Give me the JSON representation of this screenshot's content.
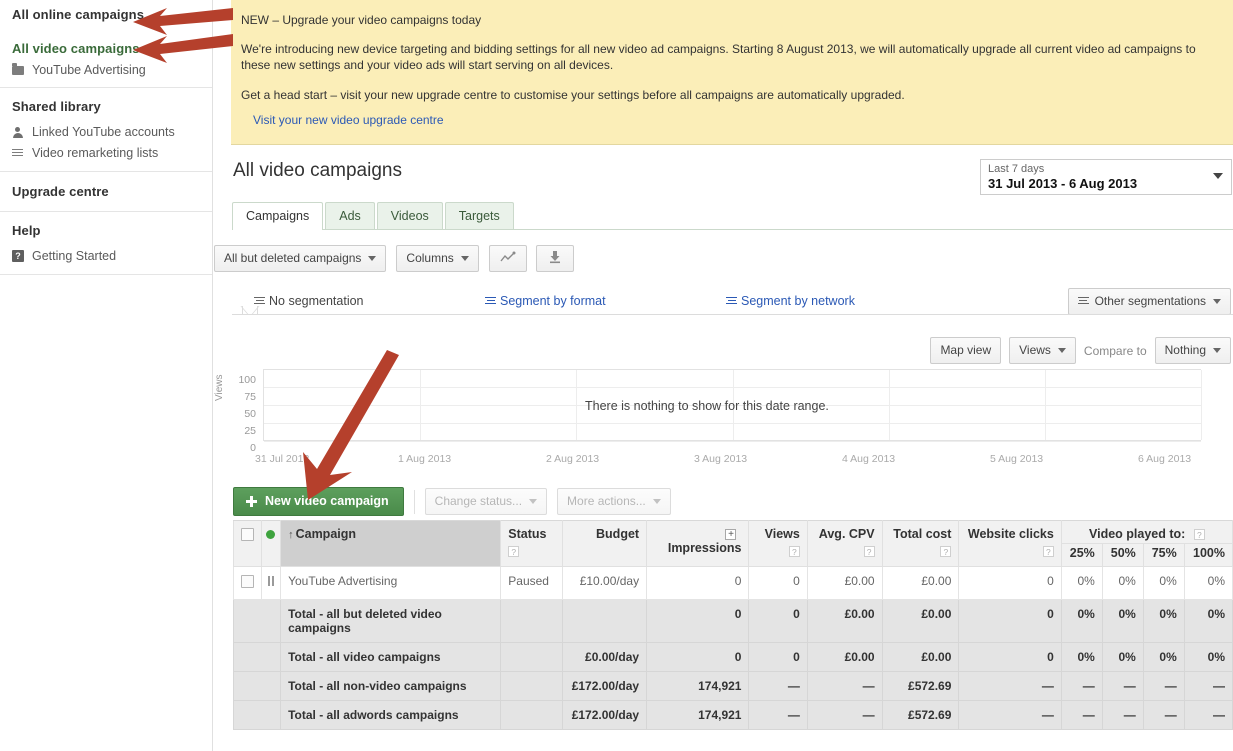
{
  "sidebar": {
    "sections": [
      {
        "items": [
          {
            "label": "All online campaigns",
            "style": "head-dark",
            "icon": ""
          },
          {
            "label": "All video campaigns",
            "style": "head-green",
            "icon": ""
          },
          {
            "label": "YouTube Advertising",
            "style": "row",
            "icon": "folder-icon"
          }
        ]
      },
      {
        "items": [
          {
            "label": "Shared library",
            "style": "head-dark",
            "icon": ""
          },
          {
            "label": "Linked YouTube accounts",
            "style": "row",
            "icon": "person-icon"
          },
          {
            "label": "Video remarketing lists",
            "style": "row",
            "icon": "list-icon"
          }
        ]
      },
      {
        "items": [
          {
            "label": "Upgrade centre",
            "style": "head-dark",
            "icon": ""
          }
        ]
      },
      {
        "items": [
          {
            "label": "Help",
            "style": "head-dark",
            "icon": ""
          },
          {
            "label": "Getting Started",
            "style": "row",
            "icon": "help-icon"
          }
        ]
      }
    ]
  },
  "banner": {
    "heading": "NEW – Upgrade your video campaigns today",
    "paragraph1": "We're introducing new device targeting and bidding settings for all new video ad campaigns. Starting 8 August 2013, we will automatically upgrade all current video ad campaigns to these new settings and your video ads will start serving on all devices.",
    "paragraph2": "Get a head start – visit your new upgrade centre to customise your settings before all campaigns are automatically upgraded.",
    "link": "Visit your new video upgrade centre",
    "bg_color": "#fbeeb8"
  },
  "header": {
    "title": "All video campaigns",
    "date_range": {
      "preset": "Last 7 days",
      "range": "31 Jul 2013 - 6 Aug 2013"
    }
  },
  "tabs": [
    {
      "label": "Campaigns",
      "active": true
    },
    {
      "label": "Ads",
      "active": false
    },
    {
      "label": "Videos",
      "active": false
    },
    {
      "label": "Targets",
      "active": false
    }
  ],
  "toolbar": {
    "filter_label": "All but deleted campaigns",
    "columns_label": "Columns",
    "graph_icon": "line-chart-icon",
    "download_icon": "download-icon"
  },
  "segmentation": {
    "no_segmentation": "No segmentation",
    "by_format": "Segment by format",
    "by_network": "Segment by network",
    "other": "Other segmentations"
  },
  "chart_controls": {
    "map_view": "Map view",
    "views": "Views",
    "compare_to": "Compare to",
    "nothing": "Nothing"
  },
  "chart_data": {
    "type": "line",
    "title": "",
    "empty_message": "There is nothing to show for this date range.",
    "xlabel": "",
    "ylabel": "Views",
    "ylim": [
      0,
      100
    ],
    "yticks": [
      100,
      75,
      50,
      25,
      0
    ],
    "x": [
      "31 Jul 2013",
      "1 Aug 2013",
      "2 Aug 2013",
      "3 Aug 2013",
      "4 Aug 2013",
      "5 Aug 2013",
      "6 Aug 2013"
    ],
    "series": [
      {
        "name": "Views",
        "values": []
      }
    ],
    "grid": true,
    "legend": "none"
  },
  "actions": {
    "new_campaign": "New video campaign",
    "change_status": "Change status...",
    "more_actions": "More actions..."
  },
  "table": {
    "headers": {
      "campaign": "Campaign",
      "status": "Status",
      "budget": "Budget",
      "impressions": "Impressions",
      "views": "Views",
      "avg_cpv": "Avg. CPV",
      "total_cost": "Total cost",
      "website_clicks": "Website clicks",
      "video_played_to": "Video played to:",
      "vpt_sub": [
        "25%",
        "50%",
        "75%",
        "100%"
      ]
    },
    "rows": [
      {
        "type": "data",
        "name": "YouTube Advertising",
        "status": "Paused",
        "budget": "£10.00/day",
        "impressions": "0",
        "views": "0",
        "avg_cpv": "£0.00",
        "total_cost": "£0.00",
        "website_clicks": "0",
        "vpt": [
          "0%",
          "0%",
          "0%",
          "0%"
        ]
      },
      {
        "type": "total",
        "name": "Total - all but deleted video campaigns",
        "status": "",
        "budget": "",
        "impressions": "0",
        "views": "0",
        "avg_cpv": "£0.00",
        "total_cost": "£0.00",
        "website_clicks": "0",
        "vpt": [
          "0%",
          "0%",
          "0%",
          "0%"
        ]
      },
      {
        "type": "total",
        "name": "Total - all video campaigns",
        "status": "",
        "budget": "£0.00/day",
        "impressions": "0",
        "views": "0",
        "avg_cpv": "£0.00",
        "total_cost": "£0.00",
        "website_clicks": "0",
        "vpt": [
          "0%",
          "0%",
          "0%",
          "0%"
        ]
      },
      {
        "type": "total",
        "name": "Total - all non-video campaigns",
        "status": "",
        "budget": "£172.00/day",
        "impressions": "174,921",
        "views": "—",
        "avg_cpv": "—",
        "total_cost": "£572.69",
        "website_clicks": "—",
        "vpt": [
          "—",
          "—",
          "—",
          "—"
        ]
      },
      {
        "type": "total",
        "name": "Total - all adwords campaigns",
        "status": "",
        "budget": "£172.00/day",
        "impressions": "174,921",
        "views": "—",
        "avg_cpv": "—",
        "total_cost": "£572.69",
        "website_clicks": "—",
        "vpt": [
          "—",
          "—",
          "—",
          "—"
        ]
      }
    ]
  },
  "annotations": {
    "arrow_color": "#b5402c",
    "count": 3
  }
}
